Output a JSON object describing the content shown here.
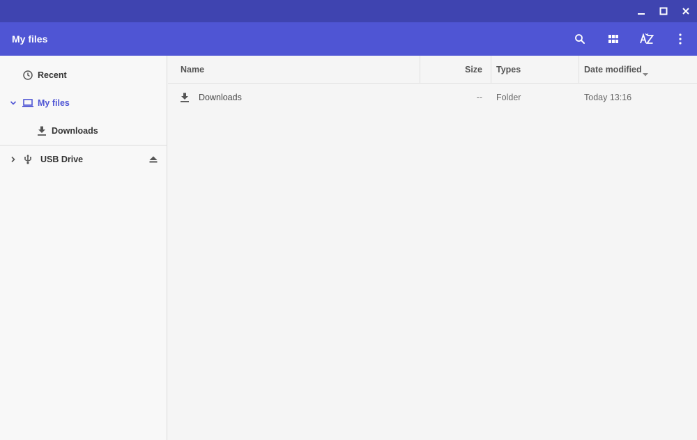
{
  "window": {
    "controls": {
      "minimize_icon": "minimize-icon",
      "maximize_icon": "maximize-icon",
      "close_icon": "close-icon"
    }
  },
  "appbar": {
    "title": "My files",
    "tools": [
      "search-icon",
      "grid-view-icon",
      "sort-az-icon",
      "more-vert-icon"
    ]
  },
  "sidebar": {
    "items": [
      {
        "label": "Recent",
        "icon": "clock-icon"
      },
      {
        "label": "My files",
        "icon": "laptop-icon",
        "expanded": true,
        "selected": true
      },
      {
        "label": "Downloads",
        "icon": "download-icon"
      },
      {
        "label": "USB Drive",
        "icon": "usb-icon",
        "expanded": false,
        "eject_icon": "eject-icon"
      }
    ]
  },
  "table": {
    "columns": {
      "name": "Name",
      "size": "Size",
      "types": "Types",
      "date_modified": "Date modified"
    },
    "sort": {
      "column": "date_modified",
      "direction": "descending"
    },
    "rows": [
      {
        "icon": "download-icon",
        "name": "Downloads",
        "size": "--",
        "type": "Folder",
        "date": "Today 13:16"
      }
    ]
  },
  "colors": {
    "titlebar": "#3f44b0",
    "appbar": "#4f55d4",
    "accent": "#4f55d4",
    "sidebar_bg": "#f8f8f8",
    "content_bg": "#f5f5f5"
  }
}
